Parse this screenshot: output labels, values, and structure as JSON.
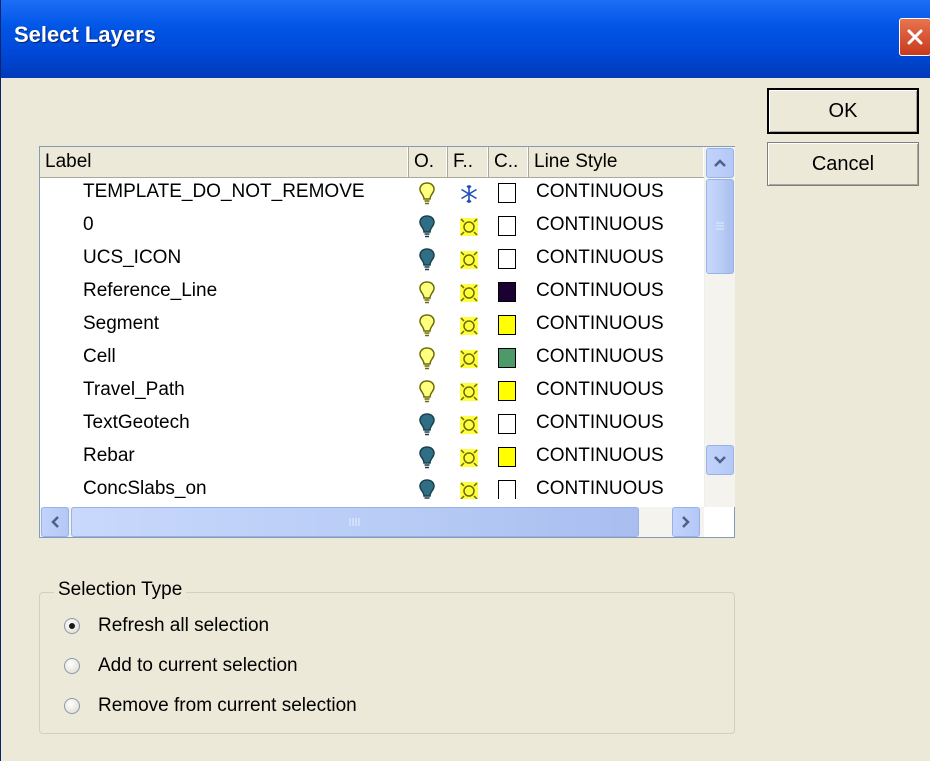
{
  "window": {
    "title": "Select Layers"
  },
  "buttons": {
    "ok": "OK",
    "cancel": "Cancel"
  },
  "list": {
    "columns": {
      "label": "Label",
      "on": "O.",
      "freeze": "F..",
      "color": "C..",
      "linestyle": "Line Style"
    },
    "rows": [
      {
        "label": "TEMPLATE_DO_NOT_REMOVE",
        "on": true,
        "frozen": true,
        "color": "#ffffff",
        "linestyle": "CONTINUOUS"
      },
      {
        "label": "0",
        "on": false,
        "frozen": false,
        "color": "#ffffff",
        "linestyle": "CONTINUOUS"
      },
      {
        "label": "UCS_ICON",
        "on": false,
        "frozen": false,
        "color": "#ffffff",
        "linestyle": "CONTINUOUS"
      },
      {
        "label": "Reference_Line",
        "on": true,
        "frozen": false,
        "color": "#1a0033",
        "linestyle": "CONTINUOUS"
      },
      {
        "label": "Segment",
        "on": true,
        "frozen": false,
        "color": "#ffff00",
        "linestyle": "CONTINUOUS"
      },
      {
        "label": "Cell",
        "on": true,
        "frozen": false,
        "color": "#4c9a6a",
        "linestyle": "CONTINUOUS"
      },
      {
        "label": "Travel_Path",
        "on": true,
        "frozen": false,
        "color": "#ffff00",
        "linestyle": "CONTINUOUS"
      },
      {
        "label": "TextGeotech",
        "on": false,
        "frozen": false,
        "color": "#ffffff",
        "linestyle": "CONTINUOUS"
      },
      {
        "label": "Rebar",
        "on": false,
        "frozen": false,
        "color": "#ffff00",
        "linestyle": "CONTINUOUS"
      },
      {
        "label": "ConcSlabs_on",
        "on": false,
        "frozen": false,
        "color": "#ffffff",
        "linestyle": "CONTINUOUS"
      }
    ]
  },
  "selection_type": {
    "title": "Selection Type",
    "options": [
      {
        "label": "Refresh all selection",
        "selected": true
      },
      {
        "label": "Add to current selection",
        "selected": false
      },
      {
        "label": "Remove from current selection",
        "selected": false
      }
    ]
  },
  "colors": {
    "titlebar": "#0055e5",
    "dialog": "#ece9d8",
    "bulb_on": "#ffff80",
    "bulb_off": "#2f6f86"
  }
}
